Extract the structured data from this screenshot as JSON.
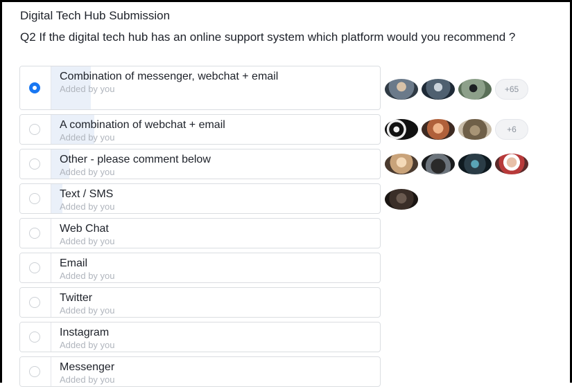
{
  "poll": {
    "title": "Digital Tech Hub Submission",
    "question": "Q2 If the digital tech hub has an online support system which platform would you recommend ?",
    "options": [
      {
        "label": "Combination of messenger, webchat + email",
        "sub": "Added by you",
        "selected": true,
        "share": 0.11,
        "more": "+65"
      },
      {
        "label": "A combination of webchat + email",
        "sub": "Added by you",
        "selected": false,
        "share": 0.12,
        "more": "+6"
      },
      {
        "label": "Other - please comment below",
        "sub": "Added by you",
        "selected": false,
        "share": 0.05,
        "more": ""
      },
      {
        "label": "Text / SMS",
        "sub": "Added by you",
        "selected": false,
        "share": 0.03,
        "more": ""
      },
      {
        "label": "Web Chat",
        "sub": "Added by you",
        "selected": false,
        "share": 0,
        "more": ""
      },
      {
        "label": "Email",
        "sub": "Added by you",
        "selected": false,
        "share": 0,
        "more": ""
      },
      {
        "label": "Twitter",
        "sub": "Added by you",
        "selected": false,
        "share": 0,
        "more": ""
      },
      {
        "label": "Instagram",
        "sub": "Added by you",
        "selected": false,
        "share": 0,
        "more": ""
      },
      {
        "label": "Messenger",
        "sub": "Added by you",
        "selected": false,
        "share": 0,
        "more": ""
      }
    ]
  },
  "colors": {
    "accent": "#1877f2",
    "bar": "#eaf0f9",
    "muted": "#b0b5bd"
  }
}
